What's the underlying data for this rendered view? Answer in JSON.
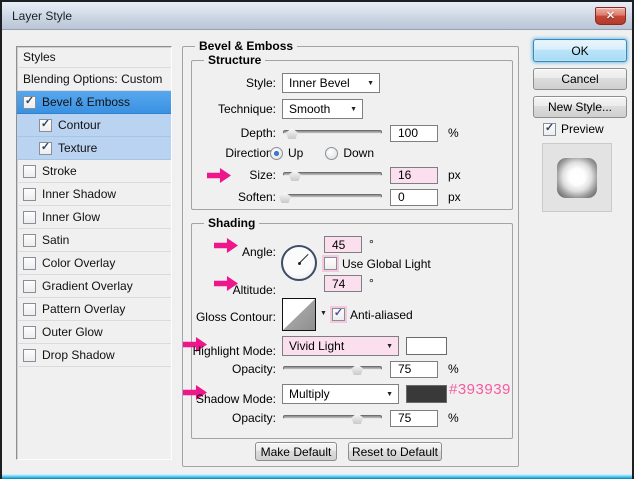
{
  "window": {
    "title": "Layer Style"
  },
  "icons": {
    "check": "✓",
    "close": "✕",
    "dropdown_arrow": "▼"
  },
  "sidebar": {
    "header": "Styles",
    "blending": "Blending Options: Custom",
    "items": [
      {
        "label": "Bevel & Emboss",
        "checked": true,
        "state": "selected"
      },
      {
        "label": "Contour",
        "checked": true,
        "state": "sub-selected"
      },
      {
        "label": "Texture",
        "checked": true,
        "state": "sub-selected"
      },
      {
        "label": "Stroke",
        "checked": false
      },
      {
        "label": "Inner Shadow",
        "checked": false
      },
      {
        "label": "Inner Glow",
        "checked": false
      },
      {
        "label": "Satin",
        "checked": false
      },
      {
        "label": "Color Overlay",
        "checked": false
      },
      {
        "label": "Gradient Overlay",
        "checked": false
      },
      {
        "label": "Pattern Overlay",
        "checked": false
      },
      {
        "label": "Outer Glow",
        "checked": false
      },
      {
        "label": "Drop Shadow",
        "checked": false
      }
    ]
  },
  "main": {
    "group_title": "Bevel & Emboss",
    "structure": {
      "title": "Structure",
      "style_label": "Style:",
      "style_value": "Inner Bevel",
      "technique_label": "Technique:",
      "technique_value": "Smooth",
      "depth_label": "Depth:",
      "depth_value": "100",
      "depth_unit": "%",
      "depth_pct": 9,
      "direction_label": "Direction:",
      "direction_up": "Up",
      "direction_down": "Down",
      "direction_selected": "Up",
      "size_label": "Size:",
      "size_value": "16",
      "size_unit": "px",
      "size_pct": 12,
      "soften_label": "Soften:",
      "soften_value": "0",
      "soften_unit": "px",
      "soften_pct": 2
    },
    "shading": {
      "title": "Shading",
      "angle_label": "Angle:",
      "angle_value": "45",
      "angle_unit": "°",
      "use_global_light_label": "Use Global Light",
      "use_global_light_checked": false,
      "altitude_label": "Altitude:",
      "altitude_value": "74",
      "altitude_unit": "°",
      "gloss_contour_label": "Gloss Contour:",
      "anti_aliased_label": "Anti-aliased",
      "anti_aliased_checked": true,
      "highlight_mode_label": "Highlight Mode:",
      "highlight_mode_value": "Vivid Light",
      "highlight_swatch": "#ffffff",
      "highlight_opacity_label": "Opacity:",
      "highlight_opacity_value": "75",
      "highlight_opacity_unit": "%",
      "highlight_opacity_pct": 75,
      "shadow_mode_label": "Shadow Mode:",
      "shadow_mode_value": "Multiply",
      "shadow_swatch": "#393939",
      "shadow_color_annotation": "#393939",
      "shadow_opacity_label": "Opacity:",
      "shadow_opacity_value": "75",
      "shadow_opacity_unit": "%",
      "shadow_opacity_pct": 75
    },
    "footer_buttons": {
      "make_default": "Make Default",
      "reset_to_default": "Reset to Default"
    }
  },
  "actions": {
    "ok": "OK",
    "cancel": "Cancel",
    "new_style": "New Style...",
    "preview": "Preview"
  },
  "colors": {
    "annotation_pink": "#f75ba1",
    "arrow_pink": "#ee168b",
    "selected_blue": "#4aa0ec",
    "sub_blue": "#b9d3f0"
  }
}
